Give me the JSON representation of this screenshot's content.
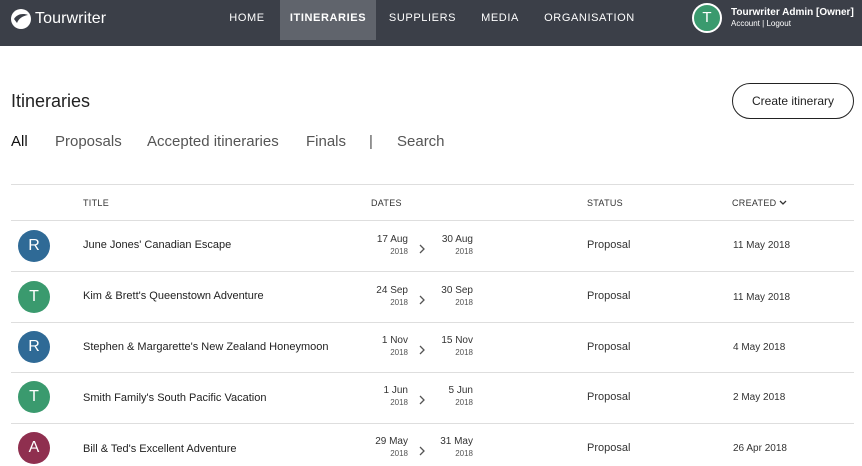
{
  "brand": {
    "name": "Tourwriter"
  },
  "nav": {
    "items": [
      {
        "label": "HOME"
      },
      {
        "label": "ITINERARIES"
      },
      {
        "label": "SUPPLIERS"
      },
      {
        "label": "MEDIA"
      },
      {
        "label": "ORGANISATION"
      }
    ],
    "active": "ITINERARIES"
  },
  "user": {
    "initial": "T",
    "name": "Tourwriter Admin [Owner]",
    "account_label": "Account",
    "separator": "|",
    "logout_label": "Logout"
  },
  "page": {
    "title": "Itineraries",
    "create_button": "Create itinerary"
  },
  "filters": {
    "items": [
      {
        "label": "All"
      },
      {
        "label": "Proposals"
      },
      {
        "label": "Accepted itineraries"
      },
      {
        "label": "Finals"
      }
    ],
    "separator": "|",
    "search_label": "Search",
    "active": "All"
  },
  "table": {
    "columns": {
      "title": "TITLE",
      "dates": "DATES",
      "status": "STATUS",
      "created": "CREATED"
    },
    "sorted_by": "CREATED",
    "rows": [
      {
        "initial": "R",
        "avatar_color": "#2f6a96",
        "title": "June Jones' Canadian Escape",
        "start_md": "17 Aug",
        "start_yr": "2018",
        "end_md": "30 Aug",
        "end_yr": "2018",
        "status": "Proposal",
        "created": "11 May 2018"
      },
      {
        "initial": "T",
        "avatar_color": "#3a9a6e",
        "title": "Kim & Brett's Queenstown Adventure",
        "start_md": "24 Sep",
        "start_yr": "2018",
        "end_md": "30 Sep",
        "end_yr": "2018",
        "status": "Proposal",
        "created": "11 May 2018"
      },
      {
        "initial": "R",
        "avatar_color": "#2f6a96",
        "title": "Stephen & Margarette's New Zealand Honeymoon",
        "start_md": "1 Nov",
        "start_yr": "2018",
        "end_md": "15 Nov",
        "end_yr": "2018",
        "status": "Proposal",
        "created": "4 May 2018"
      },
      {
        "initial": "T",
        "avatar_color": "#3a9a6e",
        "title": "Smith Family's South Pacific Vacation",
        "start_md": "1 Jun",
        "start_yr": "2018",
        "end_md": "5 Jun",
        "end_yr": "2018",
        "status": "Proposal",
        "created": "2 May 2018"
      },
      {
        "initial": "A",
        "avatar_color": "#8f2f4f",
        "title": "Bill & Ted's Excellent Adventure",
        "start_md": "29 May",
        "start_yr": "2018",
        "end_md": "31 May",
        "end_yr": "2018",
        "status": "Proposal",
        "created": "26 Apr 2018"
      }
    ]
  },
  "icons": {
    "logo": "tourwriter-logo-icon",
    "date_arrow": "chevron-right-icon",
    "sort": "chevron-down-icon"
  }
}
